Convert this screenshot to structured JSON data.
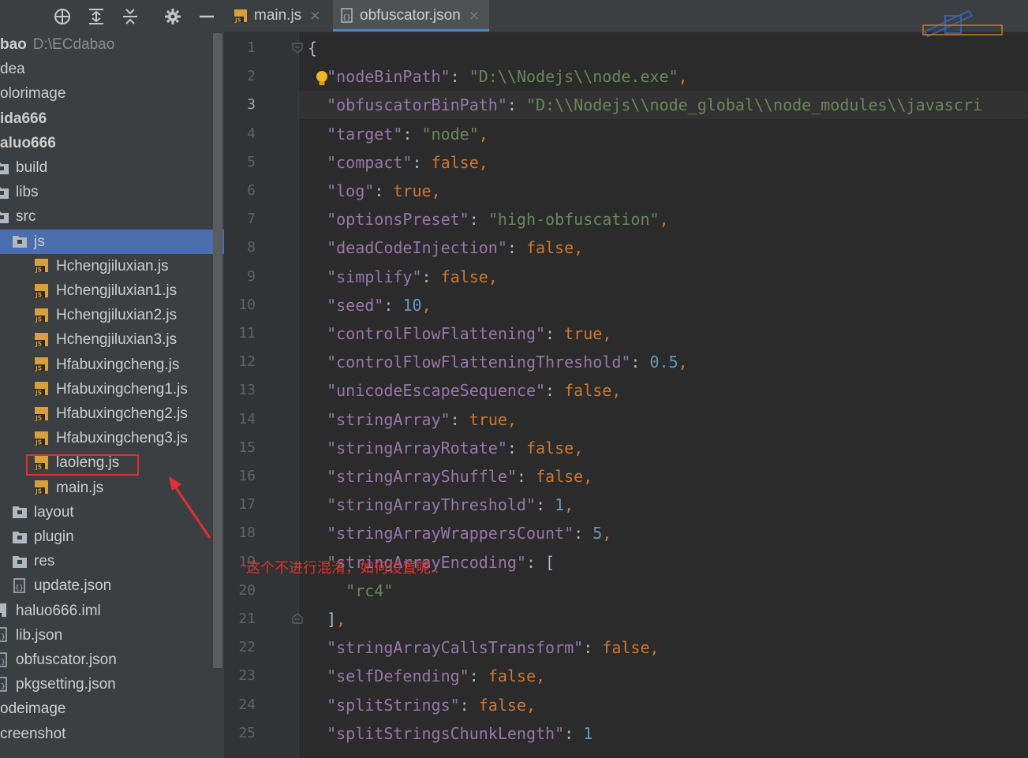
{
  "toolbar": {
    "icons": [
      "locate-icon",
      "expand-all-icon",
      "collapse-all-icon",
      "gear-icon",
      "hide-icon"
    ]
  },
  "project": {
    "root": {
      "label": "bao",
      "path": "D:\\ECdabao"
    },
    "items": [
      {
        "label": "dea"
      },
      {
        "label": "olorimage"
      },
      {
        "label": "ida666"
      },
      {
        "label": "aluo666"
      },
      {
        "label": "build"
      },
      {
        "label": "libs"
      },
      {
        "label": "src"
      },
      {
        "label": "js"
      },
      {
        "label": "Hchengjiluxian.js"
      },
      {
        "label": "Hchengjiluxian1.js"
      },
      {
        "label": "Hchengjiluxian2.js"
      },
      {
        "label": "Hchengjiluxian3.js"
      },
      {
        "label": "Hfabuxingcheng.js"
      },
      {
        "label": "Hfabuxingcheng1.js"
      },
      {
        "label": "Hfabuxingcheng2.js"
      },
      {
        "label": "Hfabuxingcheng3.js"
      },
      {
        "label": "laoleng.js"
      },
      {
        "label": "main.js"
      },
      {
        "label": "layout"
      },
      {
        "label": "plugin"
      },
      {
        "label": "res"
      },
      {
        "label": "update.json"
      },
      {
        "label": "haluo666.iml"
      },
      {
        "label": "lib.json"
      },
      {
        "label": "obfuscator.json"
      },
      {
        "label": "pkgsetting.json"
      },
      {
        "label": "odeimage"
      },
      {
        "label": "creenshot"
      }
    ]
  },
  "tabs": [
    {
      "label": "main.js",
      "close": "×",
      "active": false
    },
    {
      "label": "obfuscator.json",
      "close": "×",
      "active": true
    }
  ],
  "editor": {
    "line_numbers": [
      "1",
      "2",
      "3",
      "4",
      "5",
      "6",
      "7",
      "8",
      "9",
      "10",
      "11",
      "12",
      "13",
      "14",
      "15",
      "16",
      "17",
      "18",
      "19",
      "20",
      "21",
      "22",
      "23",
      "24",
      "25"
    ],
    "current_line": "3",
    "lines": [
      [
        {
          "t": "{",
          "c": "p"
        }
      ],
      [
        {
          "t": "  "
        },
        {
          "t": "\"nodeBinPath\"",
          "c": "k"
        },
        {
          "t": ": ",
          "c": "p"
        },
        {
          "t": "\"D:\\\\Nodejs\\\\node.exe\"",
          "c": "s"
        },
        {
          "t": ",",
          "c": "b"
        }
      ],
      [
        {
          "t": "  "
        },
        {
          "t": "\"obfuscatorBinPath\"",
          "c": "k"
        },
        {
          "t": ": ",
          "c": "p"
        },
        {
          "t": "\"D:\\\\Nodejs\\\\node_global\\\\node_modules\\\\javascri",
          "c": "s"
        }
      ],
      [
        {
          "t": "  "
        },
        {
          "t": "\"target\"",
          "c": "k"
        },
        {
          "t": ": ",
          "c": "p"
        },
        {
          "t": "\"node\"",
          "c": "s"
        },
        {
          "t": ",",
          "c": "b"
        }
      ],
      [
        {
          "t": "  "
        },
        {
          "t": "\"compact\"",
          "c": "k"
        },
        {
          "t": ": ",
          "c": "p"
        },
        {
          "t": "false",
          "c": "b"
        },
        {
          "t": ",",
          "c": "b"
        }
      ],
      [
        {
          "t": "  "
        },
        {
          "t": "\"log\"",
          "c": "k"
        },
        {
          "t": ": ",
          "c": "p"
        },
        {
          "t": "true",
          "c": "b"
        },
        {
          "t": ",",
          "c": "b"
        }
      ],
      [
        {
          "t": "  "
        },
        {
          "t": "\"optionsPreset\"",
          "c": "k"
        },
        {
          "t": ": ",
          "c": "p"
        },
        {
          "t": "\"high-obfuscation\"",
          "c": "s"
        },
        {
          "t": ",",
          "c": "b"
        }
      ],
      [
        {
          "t": "  "
        },
        {
          "t": "\"deadCodeInjection\"",
          "c": "k"
        },
        {
          "t": ": ",
          "c": "p"
        },
        {
          "t": "false",
          "c": "b"
        },
        {
          "t": ",",
          "c": "b"
        }
      ],
      [
        {
          "t": "  "
        },
        {
          "t": "\"simplify\"",
          "c": "k"
        },
        {
          "t": ": ",
          "c": "p"
        },
        {
          "t": "false",
          "c": "b"
        },
        {
          "t": ",",
          "c": "b"
        }
      ],
      [
        {
          "t": "  "
        },
        {
          "t": "\"seed\"",
          "c": "k"
        },
        {
          "t": ": ",
          "c": "p"
        },
        {
          "t": "10",
          "c": "n"
        },
        {
          "t": ",",
          "c": "b"
        }
      ],
      [
        {
          "t": "  "
        },
        {
          "t": "\"controlFlowFlattening\"",
          "c": "k"
        },
        {
          "t": ": ",
          "c": "p"
        },
        {
          "t": "true",
          "c": "b"
        },
        {
          "t": ",",
          "c": "b"
        }
      ],
      [
        {
          "t": "  "
        },
        {
          "t": "\"controlFlowFlatteningThreshold\"",
          "c": "k"
        },
        {
          "t": ": ",
          "c": "p"
        },
        {
          "t": "0.5",
          "c": "n"
        },
        {
          "t": ",",
          "c": "b"
        }
      ],
      [
        {
          "t": "  "
        },
        {
          "t": "\"unicodeEscapeSequence\"",
          "c": "k"
        },
        {
          "t": ": ",
          "c": "p"
        },
        {
          "t": "false",
          "c": "b"
        },
        {
          "t": ",",
          "c": "b"
        }
      ],
      [
        {
          "t": "  "
        },
        {
          "t": "\"stringArray\"",
          "c": "k"
        },
        {
          "t": ": ",
          "c": "p"
        },
        {
          "t": "true",
          "c": "b"
        },
        {
          "t": ",",
          "c": "b"
        }
      ],
      [
        {
          "t": "  "
        },
        {
          "t": "\"stringArrayRotate\"",
          "c": "k"
        },
        {
          "t": ": ",
          "c": "p"
        },
        {
          "t": "false",
          "c": "b"
        },
        {
          "t": ",",
          "c": "b"
        }
      ],
      [
        {
          "t": "  "
        },
        {
          "t": "\"stringArrayShuffle\"",
          "c": "k"
        },
        {
          "t": ": ",
          "c": "p"
        },
        {
          "t": "false",
          "c": "b"
        },
        {
          "t": ",",
          "c": "b"
        }
      ],
      [
        {
          "t": "  "
        },
        {
          "t": "\"stringArrayThreshold\"",
          "c": "k"
        },
        {
          "t": ": ",
          "c": "p"
        },
        {
          "t": "1",
          "c": "n"
        },
        {
          "t": ",",
          "c": "b"
        }
      ],
      [
        {
          "t": "  "
        },
        {
          "t": "\"stringArrayWrappersCount\"",
          "c": "k"
        },
        {
          "t": ": ",
          "c": "p"
        },
        {
          "t": "5",
          "c": "n"
        },
        {
          "t": ",",
          "c": "b"
        }
      ],
      [
        {
          "t": "  "
        },
        {
          "t": "\"stringArrayEncoding\"",
          "c": "k"
        },
        {
          "t": ": [",
          "c": "p"
        }
      ],
      [
        {
          "t": "    "
        },
        {
          "t": "\"rc4\"",
          "c": "s"
        }
      ],
      [
        {
          "t": "  "
        },
        {
          "t": "]",
          "c": "p"
        },
        {
          "t": ",",
          "c": "b"
        }
      ],
      [
        {
          "t": "  "
        },
        {
          "t": "\"stringArrayCallsTransform\"",
          "c": "k"
        },
        {
          "t": ": ",
          "c": "p"
        },
        {
          "t": "false",
          "c": "b"
        },
        {
          "t": ",",
          "c": "b"
        }
      ],
      [
        {
          "t": "  "
        },
        {
          "t": "\"selfDefending\"",
          "c": "k"
        },
        {
          "t": ": ",
          "c": "p"
        },
        {
          "t": "false",
          "c": "b"
        },
        {
          "t": ",",
          "c": "b"
        }
      ],
      [
        {
          "t": "  "
        },
        {
          "t": "\"splitStrings\"",
          "c": "k"
        },
        {
          "t": ": ",
          "c": "p"
        },
        {
          "t": "false",
          "c": "b"
        },
        {
          "t": ",",
          "c": "b"
        }
      ],
      [
        {
          "t": "  "
        },
        {
          "t": "\"splitStringsChunkLength\"",
          "c": "k"
        },
        {
          "t": ": ",
          "c": "p"
        },
        {
          "t": "1",
          "c": "n"
        }
      ]
    ]
  },
  "annotation": {
    "text": "这个不进行混淆，如何设置呢..",
    "color": "#e53030"
  },
  "colors": {
    "panel_bg": "#3c3f41",
    "editor_bg": "#2b2b2b",
    "selection": "#4b6eaf",
    "key": "#9876aa",
    "string": "#6a8759",
    "keyword": "#cc7832",
    "number": "#6897bb"
  }
}
